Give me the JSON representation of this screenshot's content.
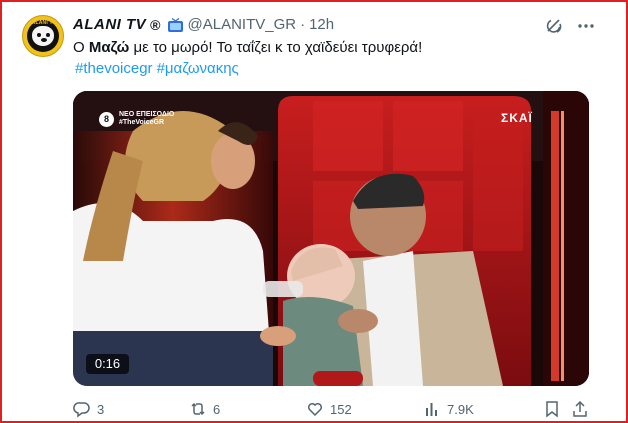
{
  "tweet": {
    "display_name": "ALANI TV",
    "registered_mark": "®",
    "handle": "@ALANITV_GR",
    "separator": "·",
    "time": "12h",
    "text_prefix": "Ο ",
    "text_bold": "Μαζώ",
    "text_suffix": " με το μωρό! Το ταΐζει κ το χαϊδεύει τρυφερά!",
    "hashtags": [
      "#thevoicegr",
      "#μαζωνακης"
    ],
    "avatar_logo_text": "ALANI TV"
  },
  "media": {
    "episode_number": "8",
    "episode_label": "ΝΕΟ ΕΠΕΙΣΟΔΙΟ",
    "episode_tag": "#TheVoiceGR",
    "channel_logo": "ΣΚΑΪ",
    "duration": "0:16"
  },
  "actions": {
    "replies": "3",
    "reposts": "6",
    "likes": "152",
    "views": "7.9K"
  },
  "icons": {
    "verified_tv": "tv-icon",
    "grok": "grok-icon",
    "more": "more-icon",
    "reply": "reply-icon",
    "repost": "repost-icon",
    "like": "heart-icon",
    "views": "views-icon",
    "bookmark": "bookmark-icon",
    "share": "share-icon"
  },
  "colors": {
    "accent": "#1d9bf0",
    "muted": "#536471",
    "frame_border": "#e02020"
  }
}
